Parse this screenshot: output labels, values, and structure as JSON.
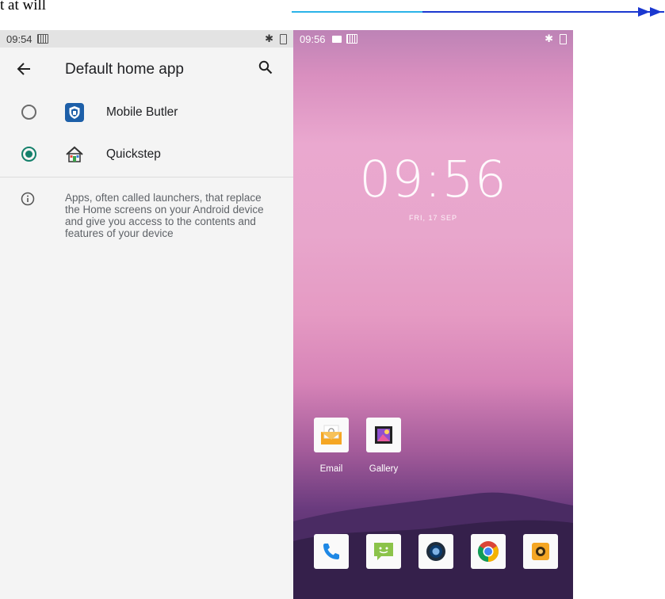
{
  "caption": "t at will",
  "left_phone": {
    "status": {
      "time": "09:54"
    },
    "appbar": {
      "title": "Default home app",
      "back_icon": "arrow-back-icon",
      "search_icon": "search-icon"
    },
    "options": [
      {
        "label": "Mobile Butler",
        "selected": false,
        "icon": "shield-icon"
      },
      {
        "label": "Quickstep",
        "selected": true,
        "icon": "house-icon"
      }
    ],
    "info_text": "Apps, often called launchers, that replace the Home screens on your Android device and give you access to the contents and features of your device",
    "accent_color": "#14806b"
  },
  "right_phone": {
    "status": {
      "time": "09:56"
    },
    "clock": "09:56",
    "date": "FRI, 17 SEP",
    "home_apps": [
      {
        "label": "Email",
        "icon": "email-icon"
      },
      {
        "label": "Gallery",
        "icon": "gallery-icon"
      }
    ],
    "dock": [
      "phone-icon",
      "messaging-icon",
      "music-icon",
      "chrome-icon",
      "camera-icon"
    ]
  }
}
